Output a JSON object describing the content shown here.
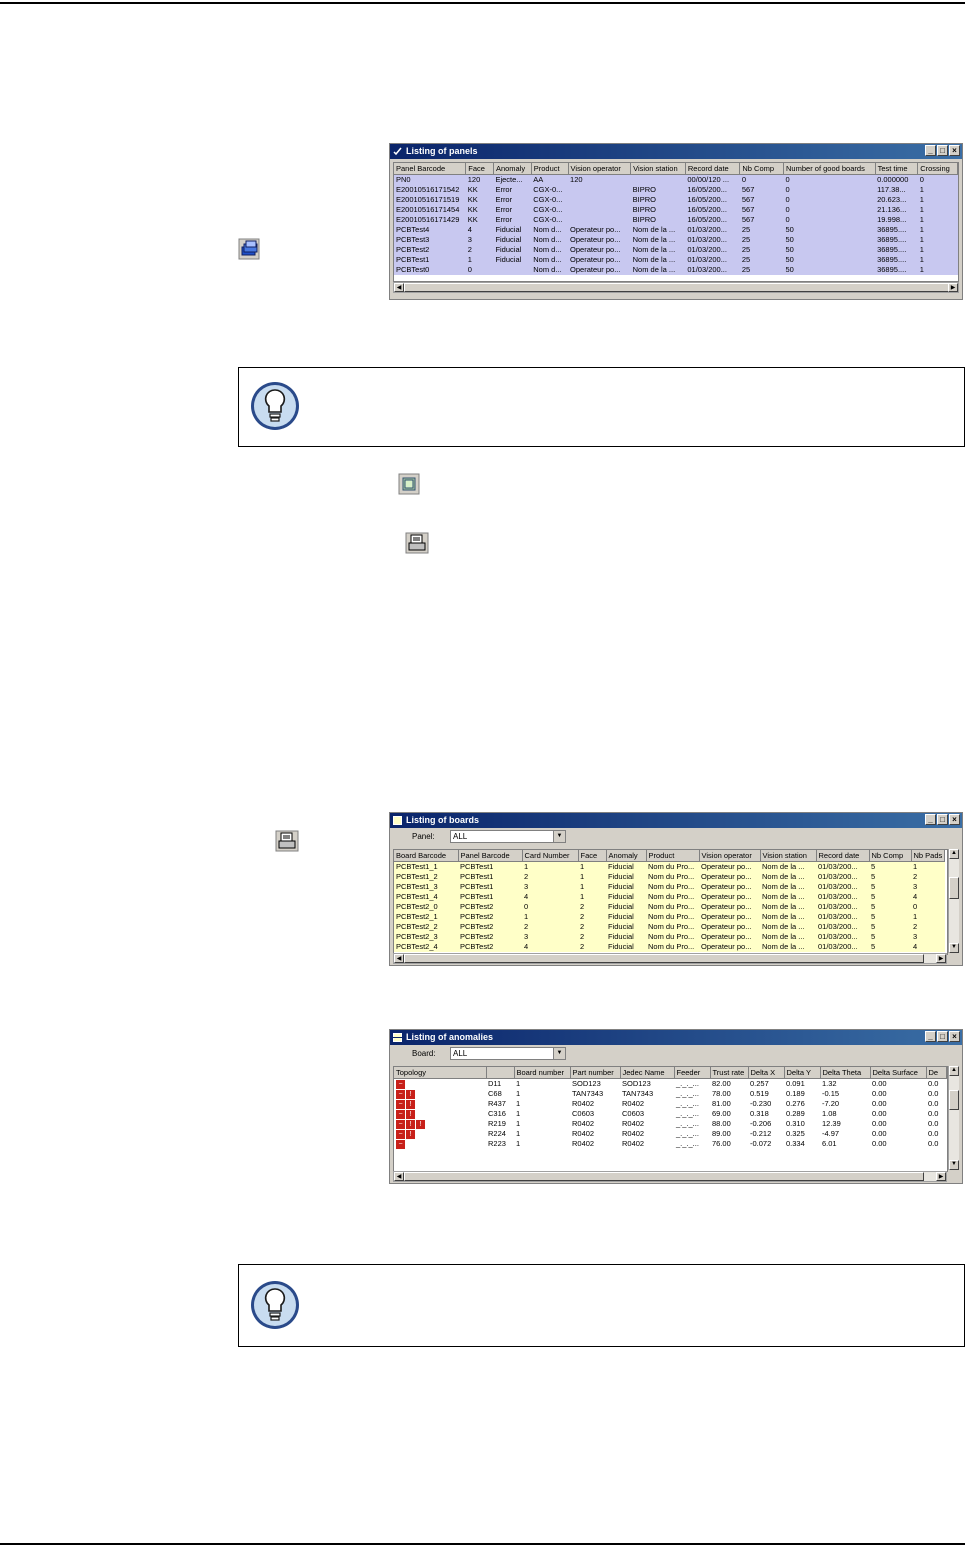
{
  "panels_window": {
    "title": "Listing of panels",
    "columns": [
      "Panel Barcode",
      "Face",
      "Anomaly",
      "Product",
      "Vision operator",
      "Vision station",
      "Record date",
      "Nb Comp",
      "Number of good boards",
      "Test time",
      "Crossing"
    ],
    "rows": [
      [
        "PN0",
        "120",
        "Ejecte...",
        "AA",
        "120",
        "",
        "00/00/120 ...",
        "0",
        "0",
        "0.000000",
        "0"
      ],
      [
        "E20010516171542",
        "KK",
        "Error",
        "CGX-0...",
        "",
        "BIPRO",
        "16/05/200...",
        "567",
        "0",
        "117.38...",
        "1"
      ],
      [
        "E20010516171519",
        "KK",
        "Error",
        "CGX-0...",
        "",
        "BIPRO",
        "16/05/200...",
        "567",
        "0",
        "20.623...",
        "1"
      ],
      [
        "E20010516171454",
        "KK",
        "Error",
        "CGX-0...",
        "",
        "BIPRO",
        "16/05/200...",
        "567",
        "0",
        "21.136...",
        "1"
      ],
      [
        "E20010516171429",
        "KK",
        "Error",
        "CGX-0...",
        "",
        "BIPRO",
        "16/05/200...",
        "567",
        "0",
        "19.998...",
        "1"
      ],
      [
        "PCBTest4",
        "4",
        "Fiducial",
        "Nom d...",
        "Operateur po...",
        "Nom de la ...",
        "01/03/200...",
        "25",
        "50",
        "36895....",
        "1"
      ],
      [
        "PCBTest3",
        "3",
        "Fiducial",
        "Nom d...",
        "Operateur po...",
        "Nom de la ...",
        "01/03/200...",
        "25",
        "50",
        "36895....",
        "1"
      ],
      [
        "PCBTest2",
        "2",
        "Fiducial",
        "Nom d...",
        "Operateur po...",
        "Nom de la ...",
        "01/03/200...",
        "25",
        "50",
        "36895....",
        "1"
      ],
      [
        "PCBTest1",
        "1",
        "Fiducial",
        "Nom d...",
        "Operateur po...",
        "Nom de la ...",
        "01/03/200...",
        "25",
        "50",
        "36895....",
        "1"
      ],
      [
        "PCBTest0",
        "0",
        "",
        "Nom d...",
        "Operateur po...",
        "Nom de la ...",
        "01/03/200...",
        "25",
        "50",
        "36895....",
        "1"
      ]
    ]
  },
  "boards_window": {
    "title": "Listing of boards",
    "filter_label": "Panel:",
    "filter_value": "ALL",
    "columns": [
      "Board Barcode",
      "Panel Barcode",
      "Card Number",
      "Face",
      "Anomaly",
      "Product",
      "Vision operator",
      "Vision station",
      "Record date",
      "Nb Comp",
      "Nb Pads"
    ],
    "rows": [
      [
        "PCBTest1_1",
        "PCBTest1",
        "1",
        "1",
        "Fiducial",
        "Nom du Pro...",
        "Operateur po...",
        "Nom de la ...",
        "01/03/200...",
        "5",
        "1"
      ],
      [
        "PCBTest1_2",
        "PCBTest1",
        "2",
        "1",
        "Fiducial",
        "Nom du Pro...",
        "Operateur po...",
        "Nom de la ...",
        "01/03/200...",
        "5",
        "2"
      ],
      [
        "PCBTest1_3",
        "PCBTest1",
        "3",
        "1",
        "Fiducial",
        "Nom du Pro...",
        "Operateur po...",
        "Nom de la ...",
        "01/03/200...",
        "5",
        "3"
      ],
      [
        "PCBTest1_4",
        "PCBTest1",
        "4",
        "1",
        "Fiducial",
        "Nom du Pro...",
        "Operateur po...",
        "Nom de la ...",
        "01/03/200...",
        "5",
        "4"
      ],
      [
        "PCBTest2_0",
        "PCBTest2",
        "0",
        "2",
        "Fiducial",
        "Nom du Pro...",
        "Operateur po...",
        "Nom de la ...",
        "01/03/200...",
        "5",
        "0"
      ],
      [
        "PCBTest2_1",
        "PCBTest2",
        "1",
        "2",
        "Fiducial",
        "Nom du Pro...",
        "Operateur po...",
        "Nom de la ...",
        "01/03/200...",
        "5",
        "1"
      ],
      [
        "PCBTest2_2",
        "PCBTest2",
        "2",
        "2",
        "Fiducial",
        "Nom du Pro...",
        "Operateur po...",
        "Nom de la ...",
        "01/03/200...",
        "5",
        "2"
      ],
      [
        "PCBTest2_3",
        "PCBTest2",
        "3",
        "2",
        "Fiducial",
        "Nom du Pro...",
        "Operateur po...",
        "Nom de la ...",
        "01/03/200...",
        "5",
        "3"
      ],
      [
        "PCBTest2_4",
        "PCBTest2",
        "4",
        "2",
        "Fiducial",
        "Nom du Pro...",
        "Operateur po...",
        "Nom de la ...",
        "01/03/200...",
        "5",
        "4"
      ]
    ]
  },
  "anomalies_window": {
    "title": "Listing of anomalies",
    "filter_label": "Board:",
    "filter_value": "ALL",
    "columns": [
      "Topology",
      "",
      "Board number",
      "Part number",
      "Jedec Name",
      "Feeder",
      "Trust rate",
      "Delta X",
      "Delta Y",
      "Delta Theta",
      "Delta Surface",
      "De"
    ],
    "rows": [
      [
        "D11",
        "1",
        "SOD123",
        "SOD123",
        "_._._...",
        "82.00",
        "0.257",
        "0.091",
        "1.32",
        "0.00",
        "0.0"
      ],
      [
        "C68",
        "1",
        "TAN7343",
        "TAN7343",
        "_._._...",
        "78.00",
        "0.519",
        "0.189",
        "-0.15",
        "0.00",
        "0.0"
      ],
      [
        "R437",
        "1",
        "R0402",
        "R0402",
        "_._._...",
        "81.00",
        "-0.230",
        "0.276",
        "-7.20",
        "0.00",
        "0.0"
      ],
      [
        "C316",
        "1",
        "C0603",
        "C0603",
        "_._._...",
        "69.00",
        "0.318",
        "0.289",
        "1.08",
        "0.00",
        "0.0"
      ],
      [
        "R219",
        "1",
        "R0402",
        "R0402",
        "_._._...",
        "88.00",
        "-0.206",
        "0.310",
        "12.39",
        "0.00",
        "0.0"
      ],
      [
        "R224",
        "1",
        "R0402",
        "R0402",
        "_._._...",
        "89.00",
        "-0.212",
        "0.325",
        "-4.97",
        "0.00",
        "0.0"
      ],
      [
        "R223",
        "1",
        "R0402",
        "R0402",
        "_._._...",
        "76.00",
        "-0.072",
        "0.334",
        "6.01",
        "0.00",
        "0.0"
      ]
    ]
  },
  "icons": [
    "panels-listing-icon",
    "window-toggle-icon",
    "print-icon",
    "bulb-tip-icon"
  ],
  "colors": {
    "panels_row_bg": "#c8c8f0",
    "boards_row_bg": "#ffffc8",
    "titlebar": "#0a246a",
    "anomaly_red": "#c8201a"
  }
}
